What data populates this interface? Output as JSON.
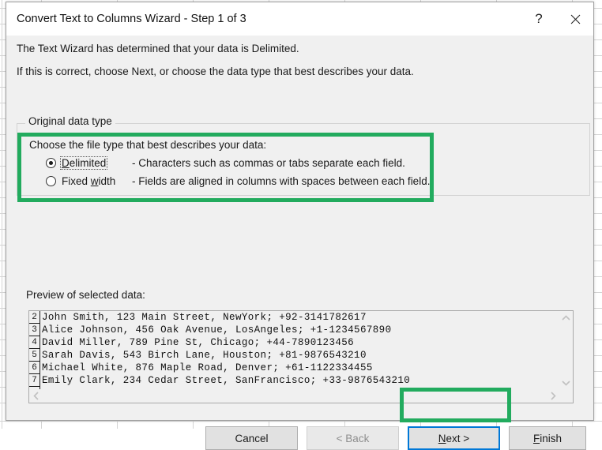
{
  "window": {
    "title": "Convert Text to Columns Wizard - Step 1 of 3",
    "help_icon": "question-mark-icon",
    "close_icon": "close-icon"
  },
  "intro": {
    "line1": "The Text Wizard has determined that your data is Delimited.",
    "line2": "If this is correct, choose Next, or choose the data type that best describes your data."
  },
  "group": {
    "legend": "Original data type",
    "instruction": "Choose the file type that best describes your data:",
    "options": [
      {
        "label": "Delimited",
        "accel": "D",
        "description": "- Characters such as commas or tabs separate each field.",
        "selected": true,
        "focused": true
      },
      {
        "label": "Fixed width",
        "accel": "w",
        "description": "- Fields are aligned in columns with spaces between each field.",
        "selected": false,
        "focused": false
      }
    ]
  },
  "preview": {
    "label": "Preview of selected data:",
    "rows": [
      {
        "num": "2",
        "text": "John Smith, 123 Main Street, NewYork; +92-3141782617"
      },
      {
        "num": "3",
        "text": "Alice Johnson, 456 Oak Avenue, LosAngeles; +1-1234567890"
      },
      {
        "num": "4",
        "text": "David Miller, 789 Pine St, Chicago; +44-7890123456"
      },
      {
        "num": "5",
        "text": "Sarah Davis, 543 Birch Lane, Houston; +81-9876543210"
      },
      {
        "num": "6",
        "text": "Michael White, 876 Maple Road, Denver; +61-1122334455"
      },
      {
        "num": "7",
        "text": "Emily Clark, 234 Cedar Street, SanFrancisco; +33-9876543210"
      },
      {
        "num": "",
        "text": ""
      }
    ],
    "scroll_up_icon": "chevron-up-icon",
    "scroll_down_icon": "chevron-down-icon",
    "scroll_left_icon": "chevron-left-icon",
    "scroll_right_icon": "chevron-right-icon"
  },
  "buttons": {
    "cancel": "Cancel",
    "back": "< Back",
    "next": "Next >",
    "next_accel": "N",
    "finish": "Finish",
    "finish_accel": "F"
  },
  "highlights": {
    "color": "#22ab5e",
    "focus_color": "#0078d7"
  }
}
